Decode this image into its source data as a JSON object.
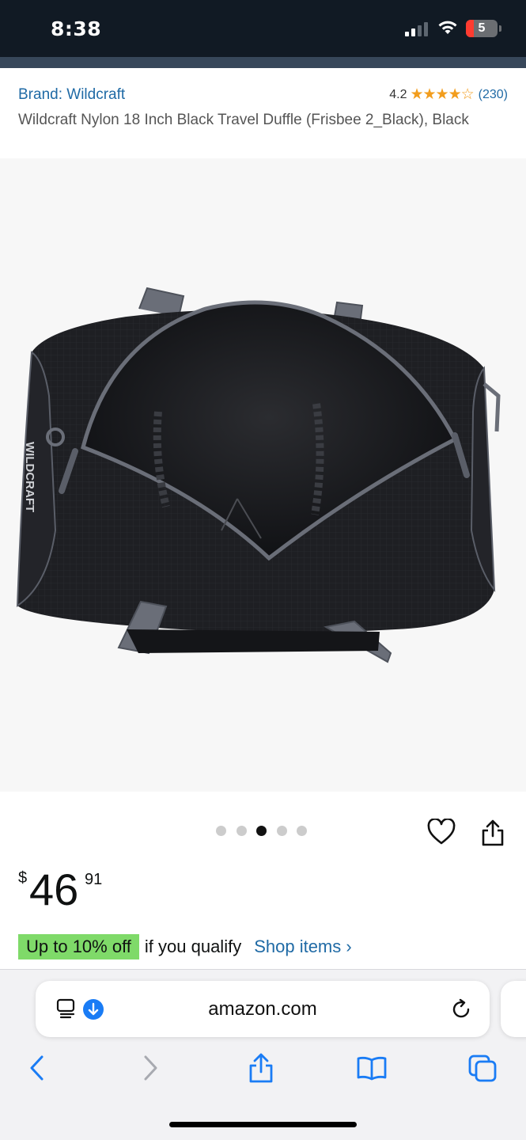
{
  "status_bar": {
    "time": "8:38",
    "battery": "5"
  },
  "header": {
    "brand_link": "Brand: Wildcraft",
    "rating_value": "4.2",
    "rating_stars": "★★★★☆",
    "rating_count": "(230)",
    "title": "Wildcraft Nylon 18 Inch Black Travel Duffle (Frisbee 2_Black), Black"
  },
  "product_image": {
    "print": "WILDCRAFT"
  },
  "carousel": {
    "total": 5,
    "active_index": 2
  },
  "price": {
    "currency": "$",
    "whole": "46",
    "fraction": "91"
  },
  "promo": {
    "badge": "Up to 10% off",
    "qualifier": "if you qualify",
    "link": "Shop items ›"
  },
  "browser": {
    "url": "amazon.com"
  },
  "colors": {
    "status_bg": "#111a24",
    "link": "#1f6aa5",
    "star": "#f29d1d",
    "promo_badge": "#7fda69",
    "browser_accent": "#1a7cf5"
  }
}
